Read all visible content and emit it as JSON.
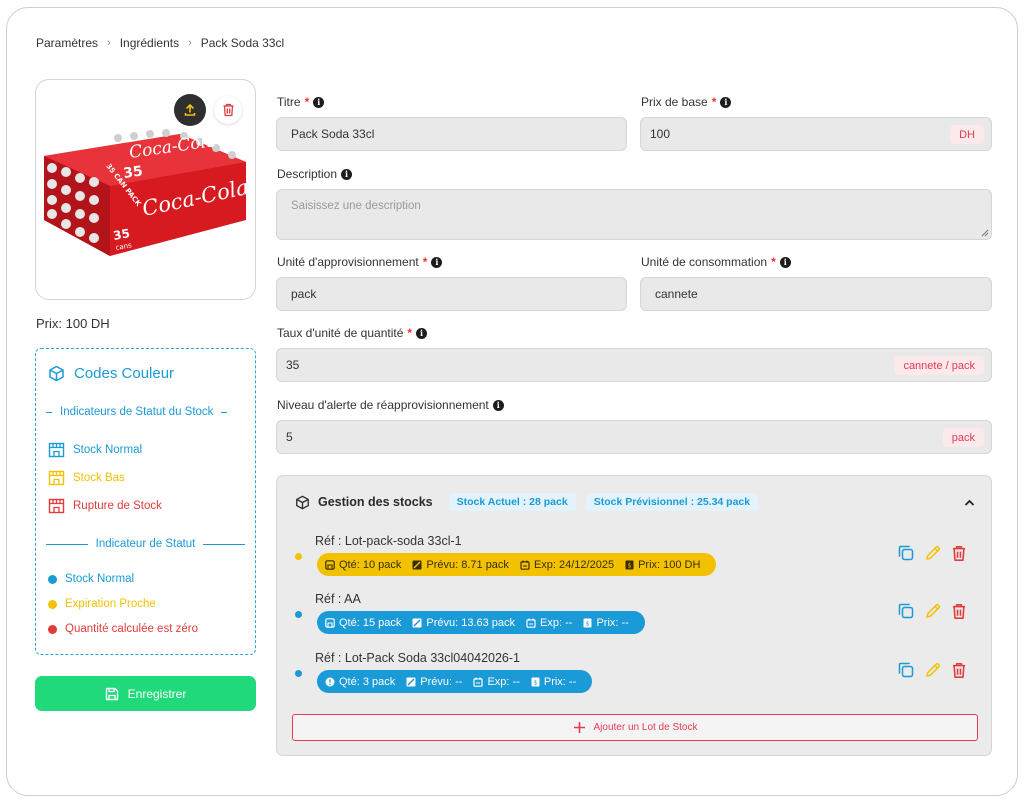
{
  "breadcrumb": [
    "Paramètres",
    "Ingrédients",
    "Pack Soda 33cl"
  ],
  "product": {
    "image_label_top": "Coca-Cola",
    "image_label_count": "35",
    "image_label_pack": "35 CAN PACK",
    "image_label_cans": "cans",
    "price_text": "Prix: 100 DH"
  },
  "legend": {
    "title": "Codes Couleur",
    "stock_status_heading": "Indicateurs de Statut du Stock",
    "stock_status_items": [
      {
        "label": "Stock Normal",
        "color": "#1a9ad6"
      },
      {
        "label": "Stock Bas",
        "color": "#f2c200"
      },
      {
        "label": "Rupture de Stock",
        "color": "#e23b3b"
      }
    ],
    "status_heading": "Indicateur de Statut",
    "status_items": [
      {
        "label": "Stock Normal",
        "color": "#1a9ad6"
      },
      {
        "label": "Expiration Proche",
        "color": "#f2c200"
      },
      {
        "label": "Quantité calculée est zéro",
        "color": "#e23b3b"
      }
    ]
  },
  "save_label": "Enregistrer",
  "form": {
    "title": {
      "label": "Titre",
      "value": "Pack Soda 33cl"
    },
    "base_price": {
      "label": "Prix de base",
      "value": "100",
      "suffix": "DH"
    },
    "description": {
      "label": "Description",
      "placeholder": "Saisissez une description"
    },
    "supply_unit": {
      "label": "Unité d'approvisionnement",
      "value": "pack"
    },
    "consumption_unit": {
      "label": "Unité de consommation",
      "value": "cannete"
    },
    "quantity_rate": {
      "label": "Taux d'unité de quantité",
      "value": "35",
      "suffix": "cannete / pack"
    },
    "alert_level": {
      "label": "Niveau d'alerte de réapprovisionnement",
      "value": "5",
      "suffix": "pack"
    }
  },
  "stock": {
    "title": "Gestion des stocks",
    "current": "Stock Actuel : 28 pack",
    "forecast": "Stock Prévisionnel : 25.34 pack",
    "lots": [
      {
        "ref": "Réf : Lot-pack-soda 33cl-1",
        "qty": "Qté: 10 pack",
        "expected": "Prévu: 8.71 pack",
        "exp": "Exp: 24/12/2025",
        "price": "Prix: 100 DH",
        "color": "#f2c200",
        "text_color": "#3a2f00",
        "qty_icon": "box-icon"
      },
      {
        "ref": "Réf : AA",
        "qty": "Qté: 15 pack",
        "expected": "Prévu: 13.63 pack",
        "exp": "Exp: --",
        "price": "Prix: --",
        "color": "#1a9ad6",
        "text_color": "#ffffff",
        "qty_icon": "box-icon"
      },
      {
        "ref": "Réf : Lot-Pack Soda 33cl04042026-1",
        "qty": "Qté: 3 pack",
        "expected": "Prévu: --",
        "exp": "Exp: --",
        "price": "Prix: --",
        "color": "#1a9ad6",
        "text_color": "#ffffff",
        "qty_icon": "alert-icon"
      }
    ],
    "add_lot_label": "Ajouter un Lot de Stock"
  }
}
